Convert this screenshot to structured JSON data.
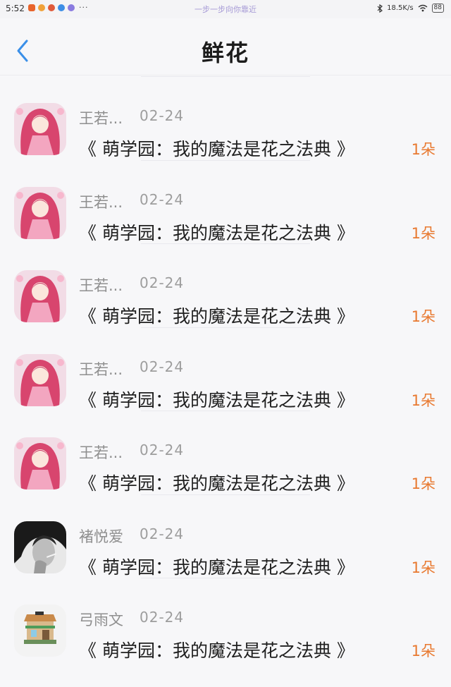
{
  "status": {
    "time": "5:52",
    "more": "···",
    "center_text": "一步一步向你靠近",
    "network": "18.5K/s",
    "battery": "88"
  },
  "header": {
    "title": "鲜花"
  },
  "gifts": [
    {
      "user": "王若...",
      "date": "02-24",
      "book": "《 萌学园：我的魔法是花之法典 》",
      "count": "1朵",
      "avatar": "anime-girl"
    },
    {
      "user": "王若...",
      "date": "02-24",
      "book": "《 萌学园：我的魔法是花之法典 》",
      "count": "1朵",
      "avatar": "anime-girl"
    },
    {
      "user": "王若...",
      "date": "02-24",
      "book": "《 萌学园：我的魔法是花之法典 》",
      "count": "1朵",
      "avatar": "anime-girl"
    },
    {
      "user": "王若...",
      "date": "02-24",
      "book": "《 萌学园：我的魔法是花之法典 》",
      "count": "1朵",
      "avatar": "anime-girl"
    },
    {
      "user": "王若...",
      "date": "02-24",
      "book": "《 萌学园：我的魔法是花之法典 》",
      "count": "1朵",
      "avatar": "anime-girl"
    },
    {
      "user": "褚悦爱",
      "date": "02-24",
      "book": "《 萌学园：我的魔法是花之法典 》",
      "count": "1朵",
      "avatar": "bw-portrait"
    },
    {
      "user": "弓雨文",
      "date": "02-24",
      "book": "《 萌学园：我的魔法是花之法典 》",
      "count": "1朵",
      "avatar": "shop-building"
    }
  ]
}
